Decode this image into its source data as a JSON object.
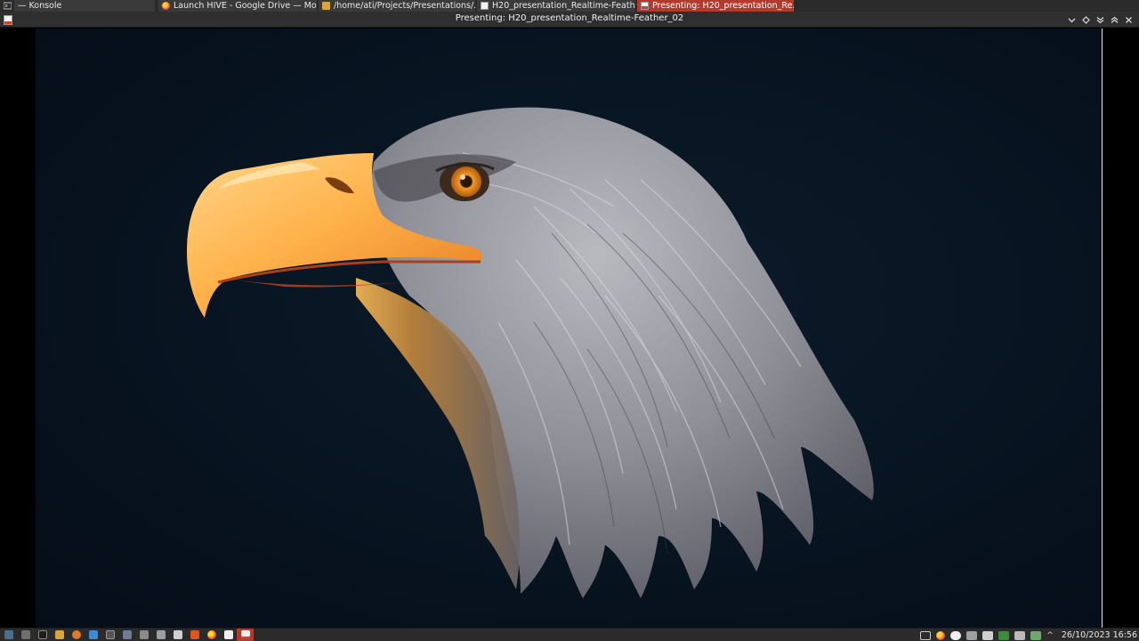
{
  "taskbar": {
    "tasks": [
      {
        "label": "— Konsole",
        "icon": "terminal-icon"
      },
      {
        "label": "Launch HIVE - Google Drive — Mo...",
        "icon": "firefox-icon"
      },
      {
        "label": "/home/ati/Projects/Presentations/...",
        "icon": "folder-icon"
      },
      {
        "label": "H20_presentation_Realtime-Feath...",
        "icon": "document-icon"
      },
      {
        "label": "Presenting: H20_presentation_Re...",
        "icon": "presentation-icon"
      }
    ]
  },
  "window": {
    "title": "Presenting: H20_presentation_Realtime-Feather_02",
    "controls": [
      "chevron-down-icon",
      "diamond-icon",
      "double-chevron-down-icon",
      "double-chevron-up-icon",
      "close-icon"
    ]
  },
  "bottom_panel": {
    "launchers": [
      "application-menu-icon",
      "system-settings-icon",
      "terminal-icon",
      "file-manager-icon",
      "browser-icon",
      "text-editor-icon",
      "screenshot-icon",
      "display-icon",
      "tools-icon",
      "trash-icon",
      "calculator-icon",
      "office-icon",
      "firefox-icon",
      "document-icon",
      "presentation-icon"
    ],
    "tray": [
      "screen-icon",
      "firefox-icon",
      "cloud-icon",
      "network-icon",
      "disk-icon",
      "vpn-icon",
      "battery-icon",
      "network-manager-icon"
    ],
    "tray_arrow": "^",
    "clock": "26/10/2023  16:56"
  },
  "colors": {
    "active_tab": "#b33b2e",
    "panel": "#2b2b2b",
    "slide_background": "#081522"
  }
}
